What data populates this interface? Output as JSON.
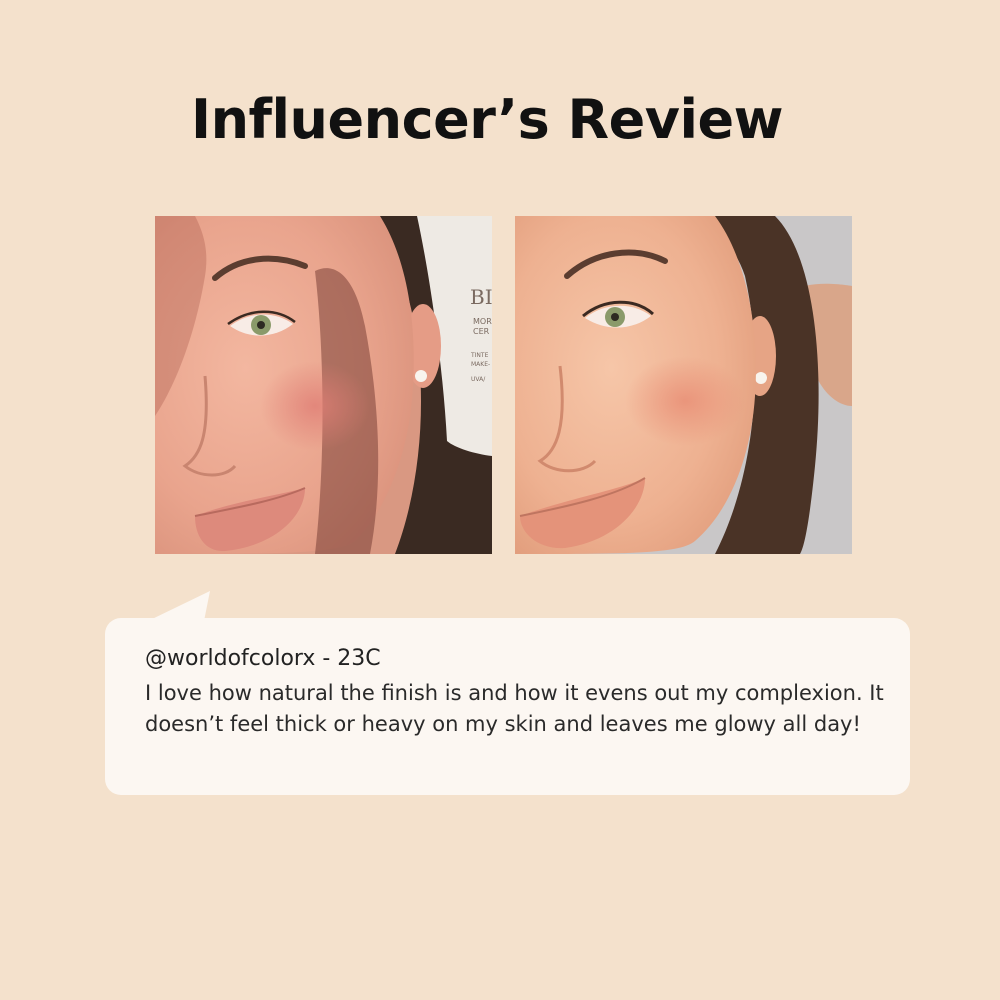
{
  "header": {
    "title": "Influencer’s Review"
  },
  "photos": [
    {
      "name": "before-photo",
      "tube_text": [
        "BI",
        "MOR",
        "CER",
        "TINTE",
        "MAKE-",
        "UVA/"
      ]
    },
    {
      "name": "after-photo"
    }
  ],
  "review": {
    "author": "@worldofcolorx - 23C",
    "text": "I love how natural the finish is and how it evens out my complexion. It doesn’t feel thick or heavy on my skin and leaves me glowy all day!"
  },
  "colors": {
    "background": "#f4e1cc",
    "bubble": "#fcf7f2",
    "title": "#111111"
  }
}
